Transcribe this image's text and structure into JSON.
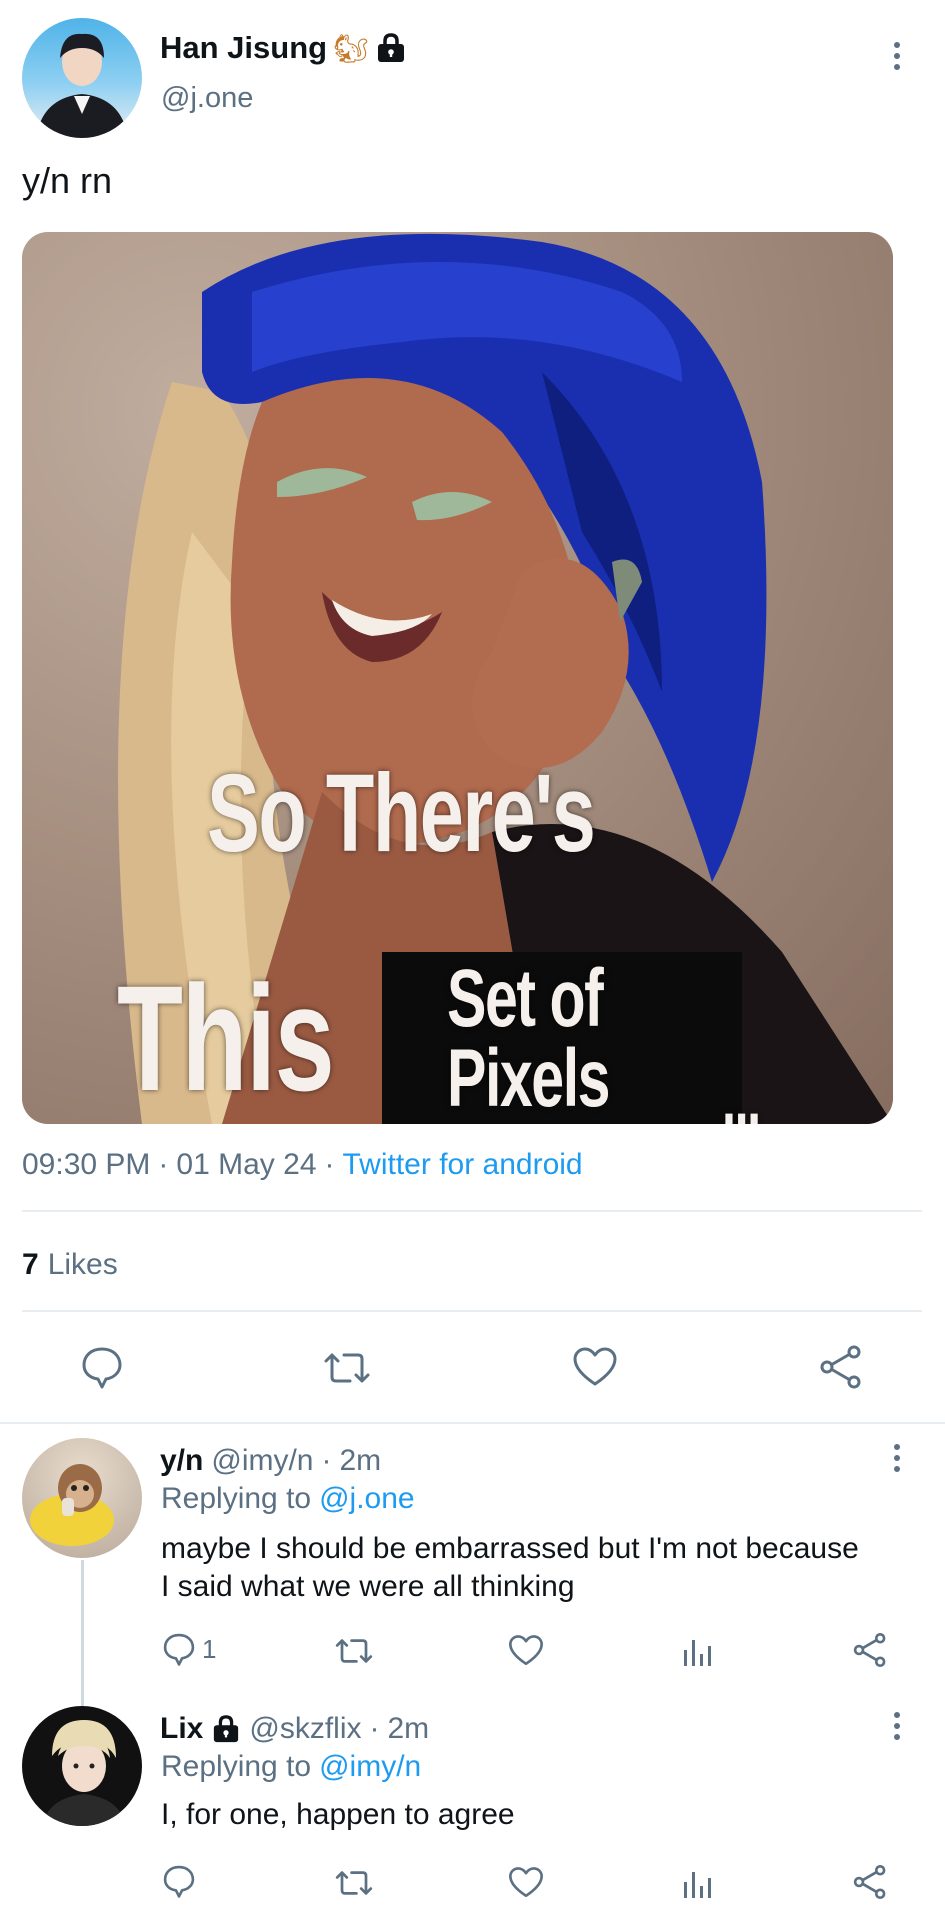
{
  "tweet": {
    "author_name": "Han Jisung",
    "author_emoji": "🐿",
    "handle": "@j.one",
    "text": "y/n rn",
    "image_caption": {
      "line1": "So There's",
      "line2a": "This",
      "line2b_top": "Set of",
      "line2b_bottom": "Pixels",
      "dots": "..."
    },
    "time": "09:30 PM",
    "sep1": "·",
    "date": "01 May 24",
    "sep2": "·",
    "source": "Twitter for android",
    "likes_count": "7",
    "likes_label": "Likes"
  },
  "replies": [
    {
      "name": "y/n",
      "handle": "@imy/n",
      "dot": "·",
      "time": "2m",
      "replying_prefix": "Replying to",
      "replying_to": "@j.one",
      "text_line1": "maybe I should be embarrassed but I'm not because",
      "text_line2": "I said what we were all thinking",
      "reply_count": "1"
    },
    {
      "name": "Lix",
      "handle": "@skzflix",
      "dot": "·",
      "time": "2m",
      "replying_prefix": "Replying to",
      "replying_to": "@imy/n",
      "text_line1": "I, for one, happen to agree",
      "reply_count": ""
    }
  ],
  "icons": {
    "lock": "lock-icon",
    "reply": "reply-icon",
    "retweet": "retweet-icon",
    "like": "heart-icon",
    "share": "share-icon",
    "analytics": "analytics-icon",
    "more": "more-vertical-icon"
  },
  "colors": {
    "link": "#1d9bf0",
    "muted": "#5b7083",
    "divider": "#e6ecf0",
    "hair_blue": "#1a2fb0"
  }
}
